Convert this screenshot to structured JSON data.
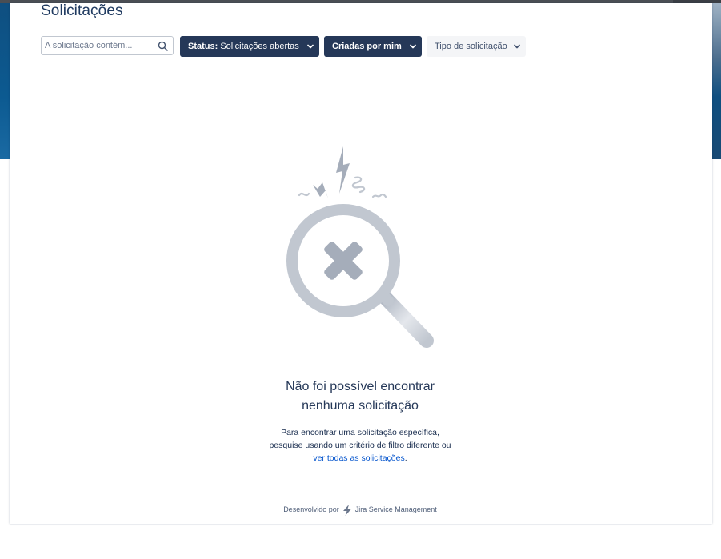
{
  "page": {
    "title": "Solicitações"
  },
  "filters": {
    "search_placeholder": "A solicitação contém...",
    "status_prefix": "Status:",
    "status_value": "Solicitações abertas",
    "created_by": "Criadas por mim",
    "request_type": "Tipo de solicitação"
  },
  "empty_state": {
    "title_line1": "Não foi possível encontrar",
    "title_line2": "nenhuma solicitação",
    "desc_line1": "Para encontrar uma solicitação específica,",
    "desc_line2": "pesquise usando um critério de filtro diferente ou",
    "link_text": "ver todas as solicitações",
    "link_suffix": "."
  },
  "footer": {
    "powered_by": "Desenvolvido por",
    "product": "Jira Service Management"
  },
  "colors": {
    "accent_dark": "#253858",
    "link": "#0052cc",
    "banner": "#0c5a91"
  },
  "icons": {
    "search": "search-icon",
    "chevron": "chevron-down-icon",
    "bolt": "jira-bolt-icon",
    "illustration": "magnifier-no-results-illustration"
  }
}
